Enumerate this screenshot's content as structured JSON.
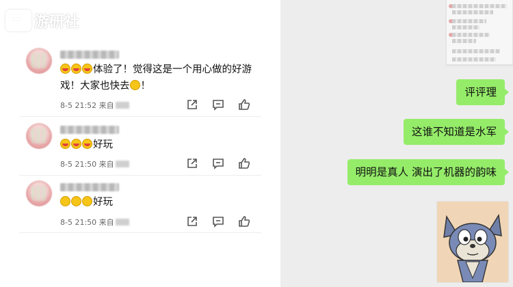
{
  "watermark": {
    "text": "游研社"
  },
  "comments": [
    {
      "content": "体验了！觉得这是一个用心做的好游戏！大家也快去",
      "trailing": "！",
      "timestamp": "8-5 21:52",
      "source_label": "来自",
      "emoji_count": 3
    },
    {
      "content": "好玩",
      "trailing": "",
      "timestamp": "8-5 21:50",
      "source_label": "来自",
      "emoji_count": 3
    },
    {
      "content": "好玩",
      "trailing": "",
      "timestamp": "8-5 21:50",
      "source_label": "来自",
      "emoji_count": 3
    }
  ],
  "actions": [
    "share-icon",
    "comment-icon",
    "like-icon"
  ],
  "chat": {
    "messages": [
      "评评理",
      "这谁不知道是水军",
      "明明是真人 演出了机器的韵味"
    ],
    "sticker": "tom-cat-sticker"
  },
  "colors": {
    "bubble": "#95ec69",
    "chat_bg": "#ededed",
    "emoji": "#f5c518"
  }
}
